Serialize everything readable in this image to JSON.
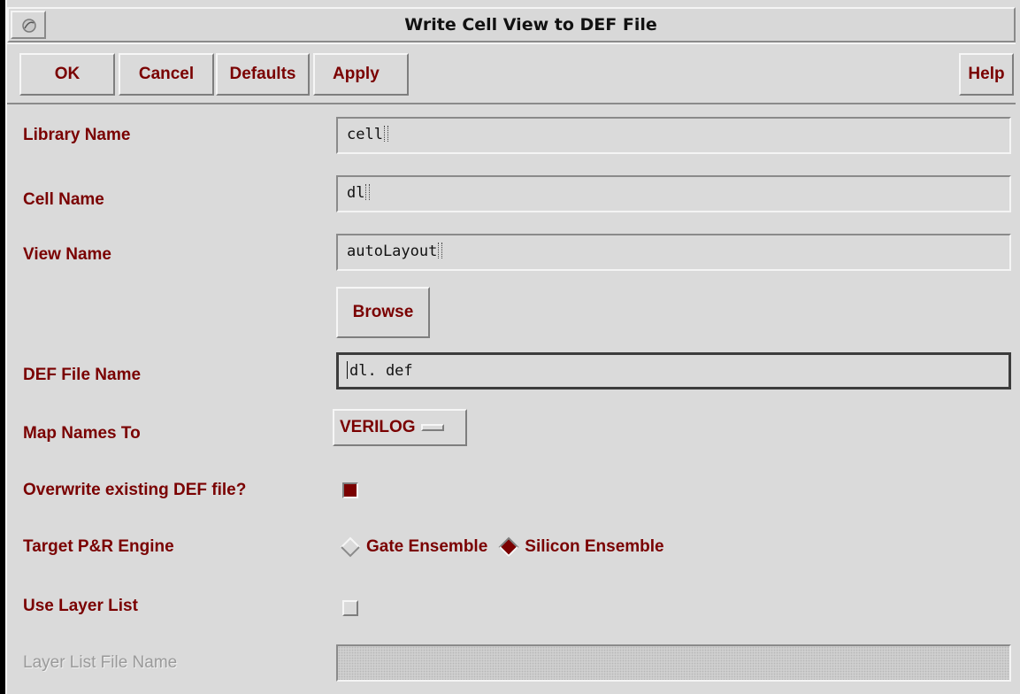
{
  "window": {
    "title": "Write Cell View to DEF File"
  },
  "buttons": {
    "ok": "OK",
    "cancel": "Cancel",
    "defaults": "Defaults",
    "apply": "Apply",
    "help": "Help"
  },
  "form": {
    "library_name": {
      "label": "Library Name",
      "value": "cell"
    },
    "cell_name": {
      "label": "Cell Name",
      "value": "dl"
    },
    "view_name": {
      "label": "View Name",
      "value": "autoLayout"
    },
    "browse_label": "Browse",
    "def_file_name": {
      "label": "DEF File Name",
      "value": "dl. def"
    },
    "map_names_to": {
      "label": "Map Names To",
      "value": "VERILOG"
    },
    "overwrite": {
      "label": "Overwrite existing DEF file?",
      "checked": true
    },
    "target_engine": {
      "label": "Target P&R Engine",
      "options": [
        "Gate Ensemble",
        "Silicon Ensemble"
      ],
      "selected": "Silicon Ensemble"
    },
    "use_layer_list": {
      "label": "Use Layer List",
      "checked": false
    },
    "layer_list_file": {
      "label": "Layer List File Name",
      "value": "",
      "disabled": true
    }
  },
  "colors": {
    "label": "#7a0000",
    "background": "#dadada"
  },
  "icons": {
    "window_menu": "window-menu-icon"
  }
}
